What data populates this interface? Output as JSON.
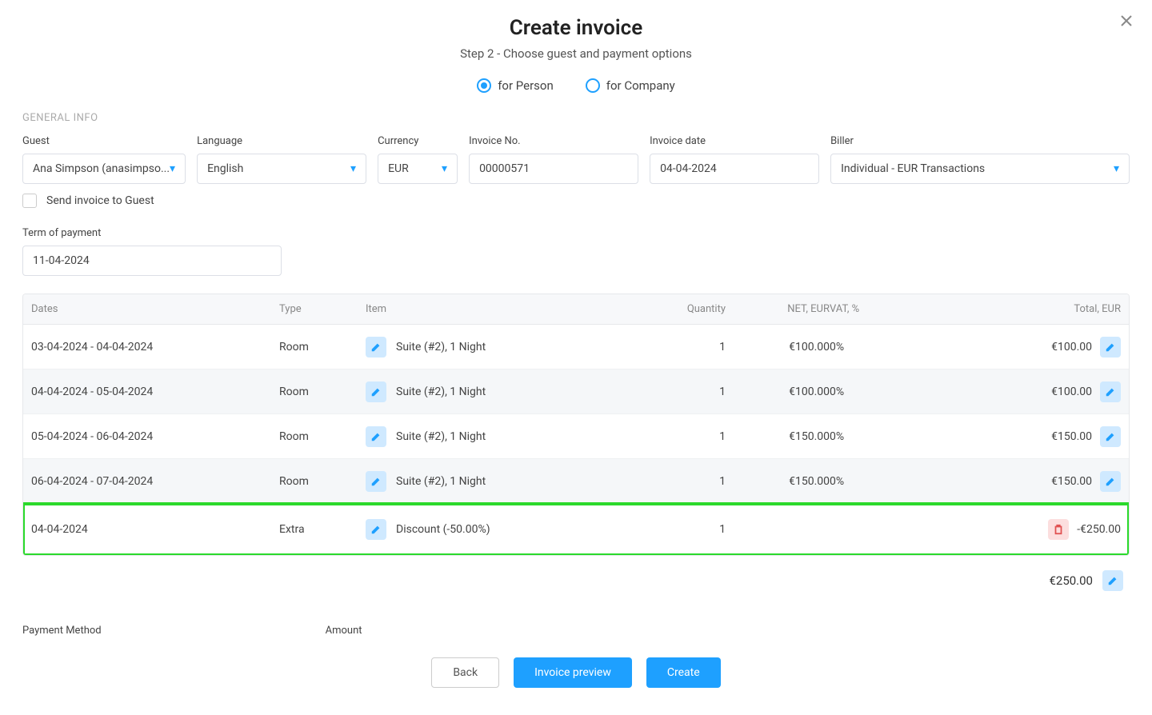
{
  "header": {
    "title": "Create invoice",
    "subtitle": "Step 2 - Choose guest and payment options",
    "radio_person": "for Person",
    "radio_company": "for Company"
  },
  "sections": {
    "general_info": "GENERAL INFO"
  },
  "fields": {
    "guest_label": "Guest",
    "guest_value": "Ana Simpson (anasimpso...",
    "language_label": "Language",
    "language_value": "English",
    "currency_label": "Currency",
    "currency_value": "EUR",
    "invoice_no_label": "Invoice No.",
    "invoice_no_value": "00000571",
    "invoice_date_label": "Invoice date",
    "invoice_date_value": "04-04-2024",
    "biller_label": "Biller",
    "biller_value": "Individual - EUR Transactions",
    "send_invoice_label": "Send invoice to Guest",
    "term_label": "Term of payment",
    "term_value": "11-04-2024"
  },
  "table": {
    "headers": {
      "dates": "Dates",
      "type": "Type",
      "item": "Item",
      "quantity": "Quantity",
      "net": "NET, EUR",
      "vat": "VAT, %",
      "total": "Total, EUR"
    },
    "rows": [
      {
        "dates": "03-04-2024 - 04-04-2024",
        "type": "Room",
        "item": "Suite (#2), 1 Night",
        "qty": "1",
        "net": "€100.00",
        "vat": "0%",
        "total": "€100.00",
        "alt": false,
        "action": "edit"
      },
      {
        "dates": "04-04-2024 - 05-04-2024",
        "type": "Room",
        "item": "Suite (#2), 1 Night",
        "qty": "1",
        "net": "€100.00",
        "vat": "0%",
        "total": "€100.00",
        "alt": true,
        "action": "edit"
      },
      {
        "dates": "05-04-2024 - 06-04-2024",
        "type": "Room",
        "item": "Suite (#2), 1 Night",
        "qty": "1",
        "net": "€150.00",
        "vat": "0%",
        "total": "€150.00",
        "alt": false,
        "action": "edit"
      },
      {
        "dates": "06-04-2024 - 07-04-2024",
        "type": "Room",
        "item": "Suite (#2), 1 Night",
        "qty": "1",
        "net": "€150.00",
        "vat": "0%",
        "total": "€150.00",
        "alt": true,
        "action": "edit"
      },
      {
        "dates": "04-04-2024",
        "type": "Extra",
        "item": "Discount (-50.00%)",
        "qty": "1",
        "net": "",
        "vat": "",
        "total": "-€250.00",
        "alt": false,
        "action": "delete",
        "highlight": true
      }
    ],
    "grand_total": "€250.00"
  },
  "footer": {
    "payment_method_label": "Payment Method",
    "amount_label": "Amount",
    "back_btn": "Back",
    "invoice_preview_btn": "Invoice preview",
    "create_btn": "Create"
  },
  "widths": {
    "guest": "212px",
    "language": "212px",
    "currency": "100px",
    "invoice_no": "212px",
    "invoice_date": "212px",
    "biller": "326px",
    "term": "324px"
  }
}
